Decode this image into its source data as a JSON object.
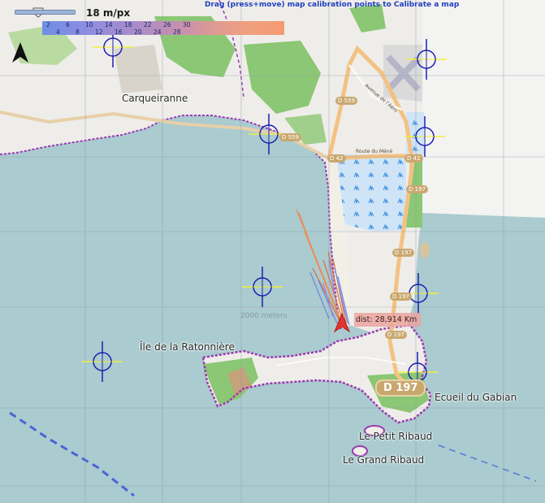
{
  "app": {
    "instruction": "Drag (press+move) map calibration points to Calibrate a map",
    "scale_label": "18 m/px"
  },
  "legend": {
    "top_values": [
      "2",
      "6",
      "10",
      "14",
      "18",
      "22",
      "26",
      "30"
    ],
    "bottom_values": [
      "4",
      "8",
      "12",
      "16",
      "20",
      "24",
      "28"
    ]
  },
  "places": {
    "carqueiranne": "Carqueiranne",
    "ratonniere": "Île de la Ratonnière",
    "ecueil": "Ecueil du Gabian",
    "petit_ribaud": "Le Petit Ribaud",
    "grand_ribaud": "Le Grand Ribaud"
  },
  "roads": {
    "d559_a": "D 559",
    "d559_b": "D 559",
    "d42_a": "D 42",
    "d42_b": "D 42",
    "d197_a": "D 197",
    "d197_b": "D 197",
    "d197_c": "D 197",
    "d197_d": "D 197",
    "d197_big": "D 197",
    "route_du_mene": "Route du Méné",
    "avenue": "Avenue de l'Aéro"
  },
  "scalebar": "2000 meters",
  "distance": "dist: 28,914 Km",
  "colors": {
    "sea": "#aacbcf",
    "land": "#f0eeea",
    "forest": "#8bc774",
    "salt_pans": "#c9e2f6",
    "coast_boundary": "#9b3ab0",
    "road_major": "#f3c283",
    "track_orange": "#ef8a4f",
    "track_blue": "#6e86de",
    "boat_marker": "#e0362b",
    "crosshair_blue": "#1a1fb0",
    "crosshair_yellow": "#f3ee3a"
  }
}
